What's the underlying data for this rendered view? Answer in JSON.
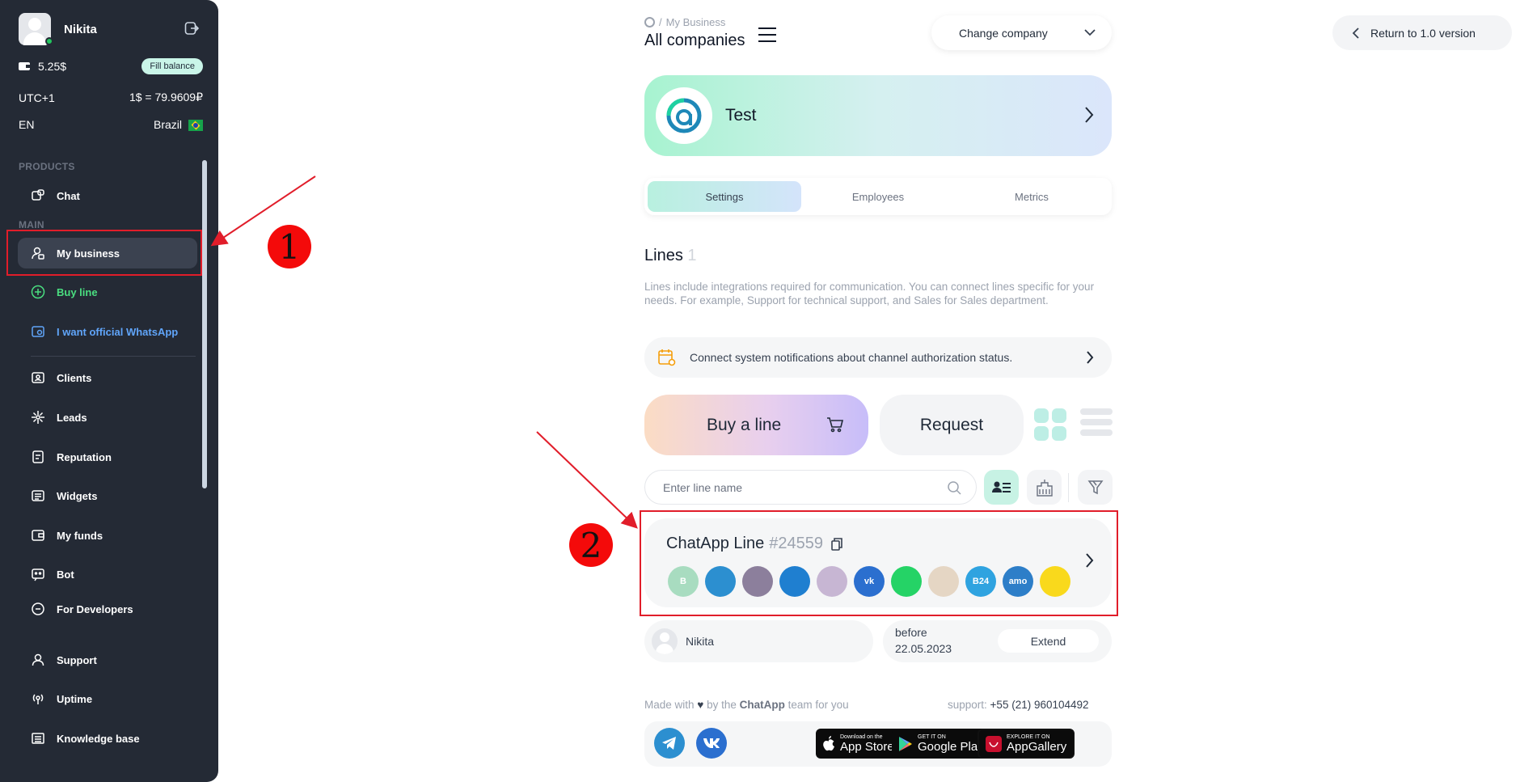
{
  "sidebar": {
    "user_name": "Nikita",
    "balance": "5.25$",
    "fill_balance_label": "Fill balance",
    "timezone": "UTC+1",
    "rate": "1$ = 79.9609₽",
    "language": "EN",
    "country": "Brazil",
    "section_products": "PRODUCTS",
    "section_main": "MAIN",
    "items": [
      {
        "label": "Chat",
        "icon": "chat-icon"
      },
      {
        "label": "My business",
        "icon": "business-icon"
      },
      {
        "label": "Buy line",
        "icon": "plus-circle-icon"
      },
      {
        "label": "I want official WhatsApp",
        "icon": "whatsapp-card-icon"
      },
      {
        "label": "Clients",
        "icon": "clients-icon"
      },
      {
        "label": "Leads",
        "icon": "leads-icon"
      },
      {
        "label": "Reputation",
        "icon": "reputation-icon"
      },
      {
        "label": "Widgets",
        "icon": "widgets-icon"
      },
      {
        "label": "My funds",
        "icon": "funds-icon"
      },
      {
        "label": "Bot",
        "icon": "bot-icon"
      },
      {
        "label": "For Developers",
        "icon": "developers-icon"
      },
      {
        "label": "Support",
        "icon": "support-icon"
      },
      {
        "label": "Uptime",
        "icon": "uptime-icon"
      },
      {
        "label": "Knowledge base",
        "icon": "knowledge-icon"
      }
    ]
  },
  "header": {
    "breadcrumb_sep": "/",
    "breadcrumb": "My Business",
    "title": "All companies",
    "company_select": "Change company",
    "return_label": "Return to 1.0 version"
  },
  "company": {
    "name": "Test"
  },
  "tabs": [
    "Settings",
    "Employees",
    "Metrics"
  ],
  "lines": {
    "title": "Lines",
    "count": "1",
    "description": "Lines include integrations required for communication. You can connect lines specific for your needs. For example, Support for technical support, and Sales for Sales department.",
    "notify": "Connect system notifications about channel authorization status.",
    "buy_label": "Buy a line",
    "request_label": "Request",
    "search_placeholder": "Enter line name"
  },
  "line_card": {
    "name": "ChatApp Line",
    "id": "#24559",
    "channels": [
      {
        "name": "business-whatsapp",
        "color": "#a8dcc0",
        "glyph": "B"
      },
      {
        "name": "telegram",
        "color": "#2c8fd0",
        "glyph": ""
      },
      {
        "name": "viber",
        "color": "#8c7f9c",
        "glyph": ""
      },
      {
        "name": "online-chat",
        "color": "#1f7fd0",
        "glyph": ""
      },
      {
        "name": "instagram",
        "color": "#c7b6d3",
        "glyph": ""
      },
      {
        "name": "vk",
        "color": "#2b6fcf",
        "glyph": "vk"
      },
      {
        "name": "whatsapp",
        "color": "#25d366",
        "glyph": ""
      },
      {
        "name": "email",
        "color": "#e5d6c4",
        "glyph": ""
      },
      {
        "name": "bitrix24",
        "color": "#2fa3e0",
        "glyph": "B24"
      },
      {
        "name": "amocrm",
        "color": "#2d7ec8",
        "glyph": "amo"
      },
      {
        "name": "avito",
        "color": "#f9d91c",
        "glyph": ""
      }
    ],
    "owner": "Nikita",
    "before_label": "before",
    "expiry": "22.05.2023",
    "extend_label": "Extend"
  },
  "footer": {
    "made_with_1": "Made with",
    "made_with_2": "by the",
    "brand": "ChatApp",
    "made_with_3": "team for you",
    "support_label": "support:",
    "support_phone": "+55 (21) 960104492",
    "stores": [
      {
        "small": "Download on the",
        "big": "App Store"
      },
      {
        "small": "GET IT ON",
        "big": "Google Play"
      },
      {
        "small": "EXPLORE IT ON",
        "big": "AppGallery"
      }
    ]
  },
  "annotations": {
    "one": "1",
    "two": "2"
  },
  "colors": {
    "sidebar_bg": "#242a35",
    "accent_green": "#4ade80",
    "annotation_red": "#e11d2a"
  }
}
